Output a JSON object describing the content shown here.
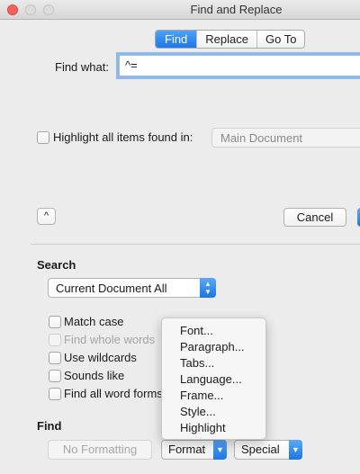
{
  "window": {
    "title": "Find and Replace"
  },
  "tabs": [
    {
      "label": "Find",
      "active": true
    },
    {
      "label": "Replace",
      "active": false
    },
    {
      "label": "Go To",
      "active": false
    }
  ],
  "find": {
    "label": "Find what:",
    "value": "^="
  },
  "highlight": {
    "label": "Highlight all items found in:",
    "checked": false,
    "scope_value": "Main Document"
  },
  "buttons": {
    "toggle_symbol": "^",
    "cancel": "Cancel"
  },
  "search": {
    "title": "Search",
    "selected": "Current Document All",
    "options": [
      {
        "label": "Match case",
        "enabled": true
      },
      {
        "label": "Find whole words",
        "enabled": false
      },
      {
        "label": "Use wildcards",
        "enabled": true
      },
      {
        "label": "Sounds like",
        "enabled": true
      },
      {
        "label": "Find all word forms",
        "enabled": true
      }
    ]
  },
  "find_section": {
    "title": "Find",
    "no_formatting": "No Formatting",
    "format": "Format",
    "special": "Special"
  },
  "format_menu": {
    "items": [
      "Font...",
      "Paragraph...",
      "Tabs...",
      "Language...",
      "Frame...",
      "Style...",
      "Highlight"
    ]
  },
  "icons": {
    "close": "close-window-icon",
    "minimize": "minimize-window-icon",
    "maximize": "zoom-window-icon",
    "select_arrows": "up-down-arrows-icon",
    "dropdown": "chevron-down-icon"
  },
  "colors": {
    "accent": "#1b78ea",
    "close": "#fc605c"
  }
}
